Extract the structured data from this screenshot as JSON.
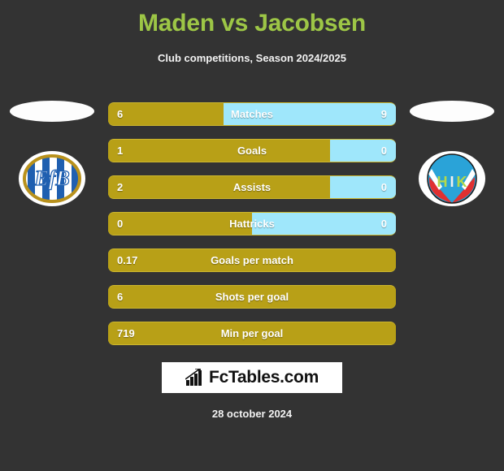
{
  "header": {
    "title": "Maden vs Jacobsen",
    "subtitle": "Club competitions, Season 2024/2025",
    "title_color": "#9dc646",
    "background_color": "#333333"
  },
  "colors": {
    "home_bar": "#b8a017",
    "away_bar": "#9fe7fb",
    "text": "#ffffff"
  },
  "teams": {
    "home": {
      "badge_name": "EfB",
      "badge_letters": "EfB"
    },
    "away": {
      "badge_name": "HIK",
      "badge_letters": [
        "H",
        "I",
        "K"
      ]
    }
  },
  "stats": [
    {
      "label": "Matches",
      "home": "6",
      "away": "9",
      "home_percent": 40,
      "dual": true
    },
    {
      "label": "Goals",
      "home": "1",
      "away": "0",
      "home_percent": 77,
      "dual": true
    },
    {
      "label": "Assists",
      "home": "2",
      "away": "0",
      "home_percent": 77,
      "dual": true
    },
    {
      "label": "Hattricks",
      "home": "0",
      "away": "0",
      "home_percent": 50,
      "dual": true
    },
    {
      "label": "Goals per match",
      "home": "0.17",
      "away": "",
      "home_percent": 100,
      "dual": false
    },
    {
      "label": "Shots per goal",
      "home": "6",
      "away": "",
      "home_percent": 100,
      "dual": false
    },
    {
      "label": "Min per goal",
      "home": "719",
      "away": "",
      "home_percent": 100,
      "dual": false
    }
  ],
  "footer": {
    "logo_text": "FcTables.com",
    "logo_icon": "bar-chart-icon",
    "date": "28 october 2024"
  }
}
